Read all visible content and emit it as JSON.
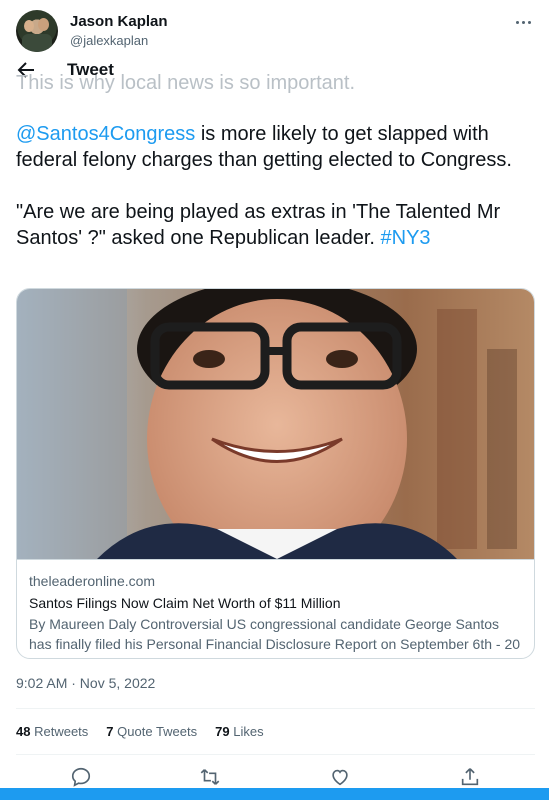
{
  "author": {
    "name": "Jason Kaplan",
    "handle": "@jalexkaplan"
  },
  "nav": {
    "title": "Tweet"
  },
  "ghost_text": "This is why local news is so important.",
  "tweet": {
    "mention": "@Santos4Congress",
    "text1": " is more likely to get slapped with federal felony charges than getting elected to Congress.",
    "text2": "\"Are we are being played as extras in 'The Talented Mr Santos' ?\" asked one Republican leader. ",
    "hashtag": "#NY3"
  },
  "card": {
    "domain": "theleaderonline.com",
    "title": "Santos Filings Now Claim Net Worth of $11 Million",
    "description": "By Maureen Daly Controversial US congressional candidate George Santos has finally filed his Personal Financial Disclosure Report on September 6th - 20 ..."
  },
  "timestamp": "9:02 AM · Nov 5, 2022",
  "stats": {
    "retweets_count": "48",
    "retweets_label": "Retweets",
    "quotes_count": "7",
    "quotes_label": "Quote Tweets",
    "likes_count": "79",
    "likes_label": "Likes"
  },
  "actions": [
    "reply-icon",
    "retweet-icon",
    "like-icon",
    "share-icon"
  ],
  "colors": {
    "accent": "#1d9bf0",
    "text": "#0f1419",
    "secondary": "#536471"
  }
}
